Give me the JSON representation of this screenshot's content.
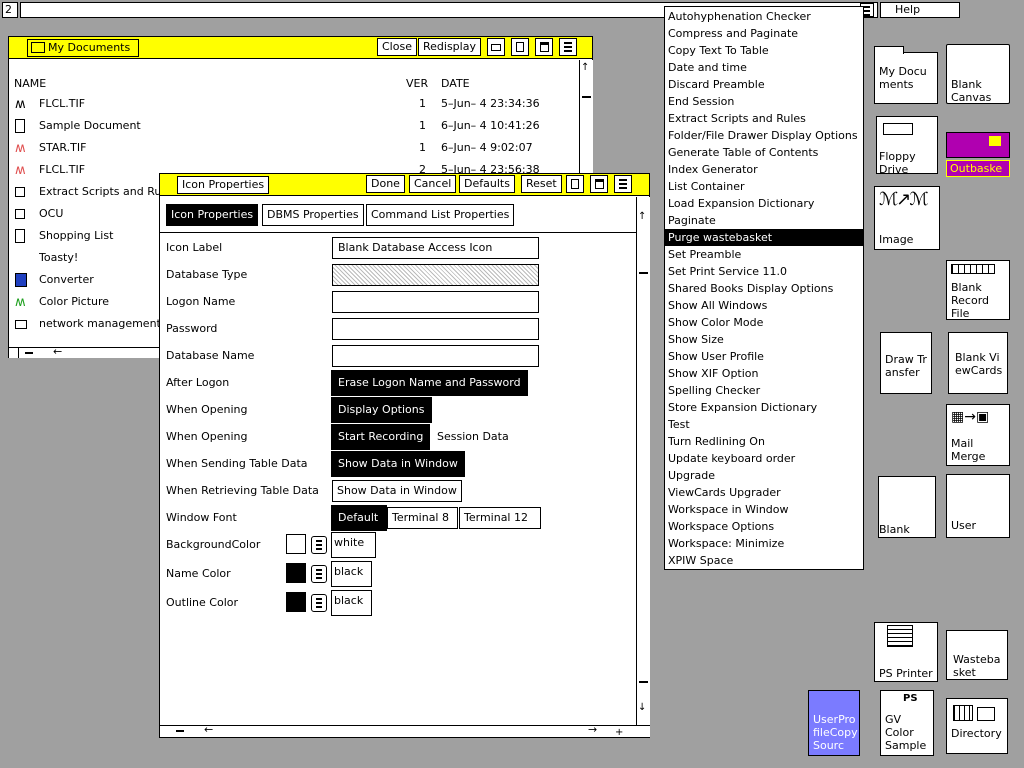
{
  "top": {
    "page_number": "2",
    "help_label": "Help"
  },
  "mydocs": {
    "title": "My Documents",
    "buttons": [
      "Close",
      "Redisplay"
    ],
    "col_name": "NAME",
    "col_ver": "VER",
    "col_date": "DATE",
    "rows": [
      {
        "icon": "image-icon",
        "name": "FLCL.TIF",
        "ver": "1",
        "date": "5–Jun– 4 23:34:36"
      },
      {
        "icon": "document-icon",
        "name": "Sample Document",
        "ver": "1",
        "date": "6–Jun– 4 10:41:26"
      },
      {
        "icon": "image-icon",
        "name": "STAR.TIF",
        "ver": "1",
        "date": "6–Jun– 4 9:02:07"
      },
      {
        "icon": "image-icon",
        "name": "FLCL.TIF",
        "ver": "2",
        "date": "5–Jun– 4 23:56:38"
      },
      {
        "icon": "script-icon",
        "name": "Extract Scripts and Rules",
        "ver": "",
        "date": ""
      },
      {
        "icon": "ocu-icon",
        "name": "OCU",
        "ver": "",
        "date": ""
      },
      {
        "icon": "document-icon",
        "name": "Shopping List",
        "ver": "",
        "date": ""
      },
      {
        "icon": "",
        "name": "Toasty!",
        "ver": "",
        "date": ""
      },
      {
        "icon": "converter-icon",
        "name": "Converter",
        "ver": "",
        "date": ""
      },
      {
        "icon": "color-picture-icon",
        "name": "Color Picture",
        "ver": "",
        "date": ""
      },
      {
        "icon": "network-icon",
        "name": "network management",
        "ver": "",
        "date": ""
      }
    ]
  },
  "props": {
    "title": "Icon Properties",
    "buttons": [
      "Done",
      "Cancel",
      "Defaults",
      "Reset"
    ],
    "tabs": [
      "Icon Properties",
      "DBMS Properties",
      "Command List Properties"
    ],
    "labels": {
      "icon_label": "Icon Label",
      "database_type": "Database Type",
      "logon_name": "Logon Name",
      "password": "Password",
      "database_name": "Database Name",
      "after_logon": "After Logon",
      "when_opening_1": "When Opening",
      "when_opening_2": "When Opening",
      "when_sending": "When Sending Table Data",
      "when_retrieving": "When Retrieving Table Data",
      "window_font": "Window Font",
      "background_color": "BackgroundColor",
      "name_color": "Name Color",
      "outline_color": "Outline Color"
    },
    "values": {
      "icon_label": "Blank Database Access Icon",
      "database_type": "",
      "logon_name": "",
      "password": "",
      "database_name": "",
      "after_logon": "Erase Logon Name and Password",
      "when_opening_1": "Display Options",
      "when_opening_2": "Start Recording",
      "when_opening_2_extra": "Session Data",
      "when_sending": "Show Data in Window",
      "when_retrieving": "Show Data in Window",
      "font_options": [
        "Default",
        "Terminal 8",
        "Terminal 12"
      ],
      "background_color": "white",
      "name_color": "black",
      "outline_color": "black"
    },
    "colors": {
      "background_swatch": "#ffffff",
      "name_swatch": "#000000",
      "outline_swatch": "#000000"
    }
  },
  "menu": {
    "items": [
      "Autohyphenation Checker",
      "Compress and Paginate",
      "Copy Text To Table",
      "Date and time",
      "Discard Preamble",
      "End Session",
      "Extract Scripts and Rules",
      "Folder/File Drawer Display Options",
      "Generate Table of Contents",
      "Index Generator",
      "List Container",
      "Load Expansion Dictionary",
      "Paginate",
      "Purge wastebasket",
      "Set Preamble",
      "Set Print Service 11.0",
      "Shared Books Display Options",
      "Show All Windows",
      "Show Color Mode",
      "Show Size",
      "Show User Profile",
      "Show XIF Option",
      "Spelling Checker",
      "Store Expansion Dictionary",
      "Test",
      "Turn Redlining On",
      "Update keyboard order",
      "Upgrade",
      "ViewCards Upgrader",
      "Workspace in Window",
      "Workspace Options",
      "Workspace: Minimize",
      "XPIW Space"
    ],
    "selected_index": 13
  },
  "desktop": {
    "my_documents": "My Documents",
    "blank_canvas": "Blank Canvas",
    "floppy_drive": "Floppy Drive",
    "outbasket": "Outbaske",
    "image": "Image",
    "blank_record_file": "Blank Record File",
    "draw_transfer": "Draw Transfer",
    "blank_viewcards": "Blank ViewCards",
    "mail_merge": "Mail Merge",
    "blank": "Blank",
    "user": "User",
    "ps_printer": "PS Printer",
    "wastebasket": "Wastebasket",
    "userprofile": "UserProfileCopySourc",
    "gv_color_sample": "GV Color Sample",
    "directory": "Directory"
  },
  "accent_colors": {
    "titlebar": "#ffff00",
    "outbasket": "#b000b0",
    "userprofile": "#7b7bff",
    "desktop": "#a0a0a0"
  }
}
